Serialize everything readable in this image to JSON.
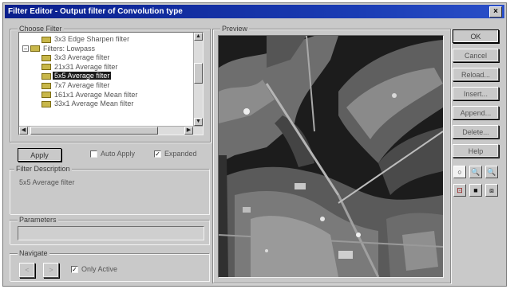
{
  "window": {
    "title": "Filter Editor - Output filter of Convolution type",
    "close_glyph": "×"
  },
  "choose_filter": {
    "group_label": "Choose Filter",
    "tree_items": [
      {
        "label": "3x3 Edge Sharpen filter",
        "type": "filter",
        "selected": false
      },
      {
        "label": "Filters: Lowpass",
        "type": "folder",
        "expanded": true,
        "selected": false
      },
      {
        "label": "3x3 Average filter",
        "type": "filter",
        "selected": false
      },
      {
        "label": "21x31 Average filter",
        "type": "filter",
        "selected": false
      },
      {
        "label": "5x5 Average filter",
        "type": "filter",
        "selected": true
      },
      {
        "label": "7x7 Average filter",
        "type": "filter",
        "selected": false
      },
      {
        "label": "161x1 Average Mean filter",
        "type": "filter",
        "selected": false
      },
      {
        "label": "33x1 Average Mean filter",
        "type": "filter",
        "selected": false
      }
    ],
    "expand_glyph": "−"
  },
  "controls": {
    "apply_label": "Apply",
    "auto_apply_label": "Auto Apply",
    "auto_apply_checked": false,
    "expanded_label": "Expanded",
    "expanded_checked": true
  },
  "description": {
    "group_label": "Filter Description",
    "text": "5x5 Average filter"
  },
  "parameters": {
    "group_label": "Parameters"
  },
  "navigate": {
    "group_label": "Navigate",
    "prev_glyph": "<",
    "next_glyph": ">",
    "only_active_label": "Only Active",
    "only_active_checked": true
  },
  "preview": {
    "group_label": "Preview"
  },
  "buttons": {
    "ok": "OK",
    "cancel": "Cancel",
    "reload": "Reload...",
    "insert": "Insert...",
    "append": "Append...",
    "delete": "Delete...",
    "help": "Help"
  },
  "tools": [
    {
      "name": "pointer-tool",
      "glyph": "○"
    },
    {
      "name": "zoom-in-tool",
      "glyph": "🔍"
    },
    {
      "name": "zoom-out-tool",
      "glyph": "🔍"
    },
    {
      "name": "fit-tool",
      "glyph": "⊡"
    },
    {
      "name": "actual-size-tool",
      "glyph": "■"
    },
    {
      "name": "fullscreen-tool",
      "glyph": "⧈"
    }
  ],
  "colors": {
    "titlebar": "#0a1e8c",
    "face": "#c9c9c9",
    "selection": "#1a1a1a"
  }
}
